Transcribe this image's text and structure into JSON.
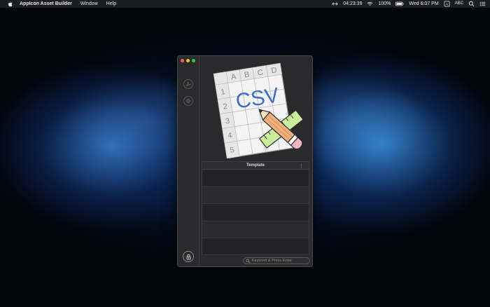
{
  "menubar": {
    "app_name": "AppIcon Asset Builder",
    "menus": [
      "Window",
      "Help"
    ],
    "clock_timer": "04:23:39",
    "battery": "100%",
    "datetime": "Wed 6:07 PM",
    "input_source": "ABC",
    "icons": [
      "apple-icon",
      "network-icon",
      "wifi-icon",
      "battery-icon",
      "user-icon",
      "spotlight-icon",
      "notification-center-icon"
    ]
  },
  "window": {
    "sidebar_icons": [
      "pdf-icon",
      "gear-icon",
      "lock-icon"
    ],
    "dropzone_image": "csv-editor-app-icon",
    "csv_icon_text": {
      "columns": [
        "A",
        "B",
        "C",
        "D"
      ],
      "rows": [
        "1",
        "2",
        "3",
        "4",
        "5"
      ],
      "label": "CSV"
    },
    "table": {
      "header": "Template",
      "row_count": 5
    },
    "search": {
      "placeholder": "Keyword & Press Enter",
      "value": ""
    }
  },
  "colors": {
    "close": "#fc5f57",
    "minimize": "#fdbc2e",
    "maximize": "#28c840",
    "csv_blue": "#3c6fc8"
  }
}
